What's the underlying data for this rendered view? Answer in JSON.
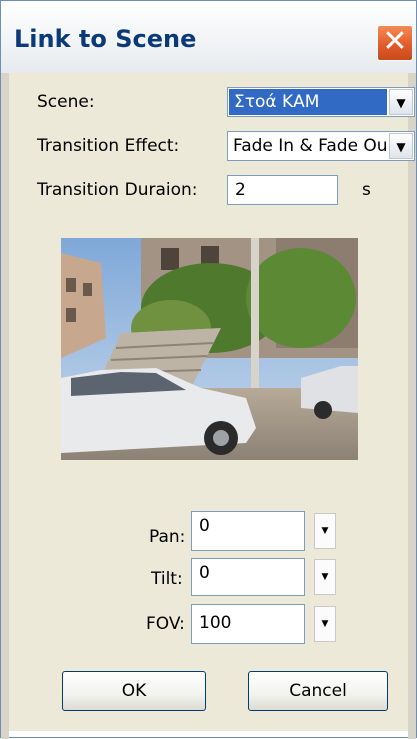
{
  "window": {
    "title": "Link to Scene"
  },
  "scene": {
    "label": "Scene:",
    "value": "Στοά ΚΑΜ"
  },
  "transition_effect": {
    "label": "Transition Effect:",
    "value": "Fade In & Fade Out"
  },
  "transition_duration": {
    "label": "Transition Duraion:",
    "value": "2",
    "unit": "s"
  },
  "preview": {
    "alt": "Panorama preview"
  },
  "pan": {
    "label": "Pan:",
    "value": "0"
  },
  "tilt": {
    "label": "Tilt:",
    "value": "0"
  },
  "fov": {
    "label": "FOV:",
    "value": "100"
  },
  "buttons": {
    "ok": "OK",
    "cancel": "Cancel"
  },
  "icons": {
    "close": "close-icon",
    "dropdown": "chevron-down-icon",
    "spin": "spin-down-icon"
  }
}
